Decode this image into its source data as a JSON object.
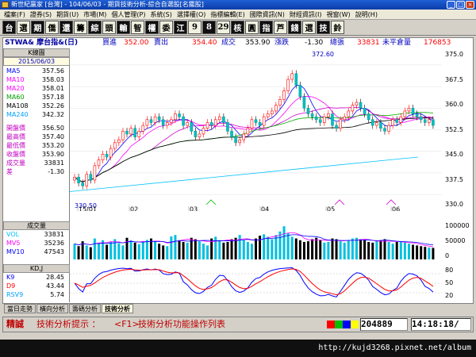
{
  "window": {
    "title": "新世紀贏家 [台灣] - 104/06/03 - 期貨技術分析-綜合自選股[名鑑股]"
  },
  "menu": [
    "檔案(F)",
    "證券(S)",
    "期貨(U)",
    "市場(M)",
    "個人管理(P)",
    "系統(S)",
    "選擇權(O)",
    "指標編輯(E)",
    "國際資訊(N)",
    "財經資訊(I)",
    "視窗(W)",
    "說明(H)"
  ],
  "toolbar": {
    "buttons": [
      "台",
      "選",
      "期",
      "僑",
      "還",
      "籌",
      "綜",
      "頭",
      "輸",
      "智",
      "權",
      "委",
      "江",
      "9",
      "8",
      "29",
      "核",
      "圓",
      "指",
      "芦",
      "錢",
      "選",
      "技",
      "鈴"
    ]
  },
  "info": {
    "symbol": "STWA& 摩台指&(日)",
    "bid_label": "買進",
    "bid": "352.00",
    "ask_label": "賣出",
    "ask": "354.40",
    "last_label": "成交",
    "last": "353.90",
    "chg_label": "漲跌",
    "chg": "-1.30",
    "vol_label": "總張",
    "vol": "33831",
    "oi_label": "未平倉量",
    "oi": "176853"
  },
  "panel": {
    "ktitle": "K線圖",
    "date": "2015/06/03",
    "ma": [
      {
        "k": "MA5",
        "v": "357.56",
        "c": "#0000ff"
      },
      {
        "k": "MA10",
        "v": "358.03",
        "c": "#ff00ff"
      },
      {
        "k": "MA20",
        "v": "358.01",
        "c": "#ff00ff"
      },
      {
        "k": "MA60",
        "v": "357.18",
        "c": "#00a000"
      },
      {
        "k": "MA108",
        "v": "352.26",
        "c": "#000000"
      },
      {
        "k": "MA240",
        "v": "342.32",
        "c": "#00a0ff"
      }
    ],
    "ohlc": [
      {
        "k": "開盤價",
        "v": "356.50"
      },
      {
        "k": "最高價",
        "v": "357.40"
      },
      {
        "k": "最低價",
        "v": "353.20"
      },
      {
        "k": "收盤價",
        "v": "353.90"
      },
      {
        "k": "成交量",
        "v": "33831"
      },
      {
        "k": "差",
        "v": "-1.30"
      }
    ],
    "voltitle": "成交量",
    "vols": [
      {
        "k": "VOL",
        "v": "33831",
        "c": "#00c0ff"
      },
      {
        "k": "MV5",
        "v": "35236",
        "c": "#ff00ff"
      },
      {
        "k": "MV10",
        "v": "47543",
        "c": "#0000ff"
      }
    ],
    "kdtitle": "KD,J",
    "kds": [
      {
        "k": "K9",
        "v": "28.45",
        "c": "#0000ff"
      },
      {
        "k": "D9",
        "v": "43.44",
        "c": "#ff0000"
      },
      {
        "k": "RSV9",
        "v": "5.74",
        "c": "#00a0ff"
      }
    ]
  },
  "chart_data": {
    "type": "candlestick",
    "price_axis": {
      "ticks": [
        "375.0",
        "367.5",
        "360.0",
        "352.5",
        "345.0",
        "337.5",
        "330.0"
      ],
      "max": "372.60",
      "min": "330.50"
    },
    "x_ticks": [
      "15/01",
      "02",
      "03",
      "04",
      "05",
      "06"
    ],
    "volume_axis": {
      "ticks": [
        "100000",
        "50000",
        "0"
      ]
    },
    "kd_axis": {
      "ticks": [
        "80",
        "50",
        "20"
      ]
    },
    "close": [
      336,
      334,
      333,
      337,
      335,
      340,
      342,
      344,
      343,
      346,
      348,
      349,
      352,
      351,
      353,
      350,
      352,
      354,
      356,
      355,
      357,
      356,
      354,
      355,
      356,
      358,
      357,
      354,
      355,
      352,
      350,
      351,
      353,
      355,
      354,
      356,
      357,
      355,
      352,
      350,
      348,
      349,
      351,
      353,
      356,
      355,
      354,
      357,
      358,
      359,
      361,
      363,
      366,
      370,
      372,
      368,
      364,
      360,
      358,
      357,
      356,
      355,
      357,
      358,
      354,
      353,
      356,
      357,
      359,
      361,
      362,
      360,
      358,
      356,
      354,
      355,
      353,
      352,
      354,
      356,
      355,
      357,
      359,
      360,
      358,
      357,
      356,
      355,
      356,
      354
    ],
    "volume": [
      45,
      38,
      52,
      40,
      35,
      60,
      48,
      55,
      42,
      50,
      58,
      46,
      40,
      62,
      55,
      48,
      44,
      50,
      56,
      60,
      52,
      45,
      40,
      38,
      66,
      70,
      55,
      50,
      48,
      62,
      58,
      52,
      45,
      40,
      60,
      65,
      55,
      48,
      50,
      58,
      62,
      70,
      55,
      50,
      45,
      60,
      68,
      72,
      65,
      58,
      70,
      80,
      95,
      75,
      65,
      60,
      55,
      50,
      52,
      58,
      62,
      55,
      48,
      50,
      60,
      58,
      52,
      48,
      55,
      60,
      62,
      58,
      55,
      50,
      48,
      52,
      55,
      58,
      50,
      45,
      50,
      52,
      48,
      45,
      42,
      40,
      38,
      36,
      34,
      33
    ]
  },
  "tabs": [
    "當日走勢",
    "橫向分析",
    "籌碼分析",
    "技術分析"
  ],
  "status": {
    "label": "精誠",
    "hint": "技術分析提示 ：",
    "fkey": "<F1>",
    "hint2": "技術分析功能操作列表",
    "counter": "204889",
    "time": "14:18:18/"
  },
  "watermark": "http://kujd3268.pixnet.net/album"
}
